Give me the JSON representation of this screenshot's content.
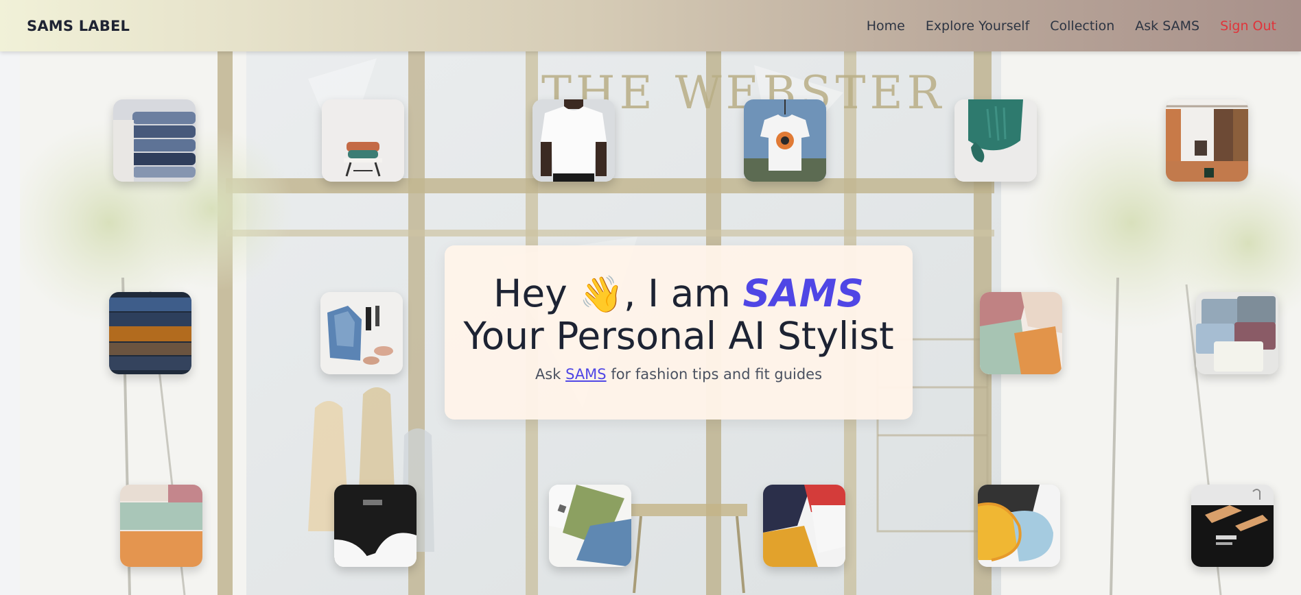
{
  "header": {
    "brand": "SAMS LABEL",
    "nav": [
      {
        "label": "Home"
      },
      {
        "label": "Explore Yourself"
      },
      {
        "label": "Collection"
      },
      {
        "label": "Ask SAMS"
      },
      {
        "label": "Sign Out"
      }
    ]
  },
  "hero": {
    "background_sign": "THE WEBSTER",
    "headline_prefix": "Hey ",
    "wave_emoji": "👋",
    "headline_mid": ", I am ",
    "assistant_name": "SAMS",
    "headline_line2": "Your Personal AI Stylist",
    "sub_prefix": "Ask ",
    "sub_link": "SAMS",
    "sub_suffix": " for fashion tips and fit guides"
  },
  "thumbnails": [
    {
      "name": "folded-jeans-thumbnail",
      "icon": "jeans-stack"
    },
    {
      "name": "sweater-on-stool-thumbnail",
      "icon": "sweater-stool"
    },
    {
      "name": "white-tshirt-thumbnail",
      "icon": "white-tshirt"
    },
    {
      "name": "hanging-graphic-tee-thumbnail",
      "icon": "hanging-tee"
    },
    {
      "name": "green-knit-sleeve-thumbnail",
      "icon": "knit-sleeve"
    },
    {
      "name": "clothing-rack-thumbnail",
      "icon": "clothing-rack"
    },
    {
      "name": "denim-stack-thumbnail",
      "icon": "denim-stack"
    },
    {
      "name": "denim-jacket-flatlay-thumbnail",
      "icon": "jacket-flatlay"
    },
    {
      "name": "pastel-tees-thumbnail",
      "icon": "pastel-tees"
    },
    {
      "name": "folded-shirts-thumbnail",
      "icon": "folded-shirts"
    },
    {
      "name": "stacked-tees-thumbnail",
      "icon": "stacked-tees"
    },
    {
      "name": "black-tee-thumbnail",
      "icon": "black-tee"
    },
    {
      "name": "olive-blue-tees-thumbnail",
      "icon": "olive-tees"
    },
    {
      "name": "navy-red-mustard-tees-thumbnail",
      "icon": "multi-tees"
    },
    {
      "name": "hoodie-stack-thumbnail",
      "icon": "hoodie-stack"
    },
    {
      "name": "black-tee-hanger-thumbnail",
      "icon": "hanger-tee"
    }
  ],
  "colors": {
    "accent": "#4f46e5",
    "signout": "#e0343a",
    "text_dark": "#1d2333",
    "card_bg": "#fff4e9"
  }
}
